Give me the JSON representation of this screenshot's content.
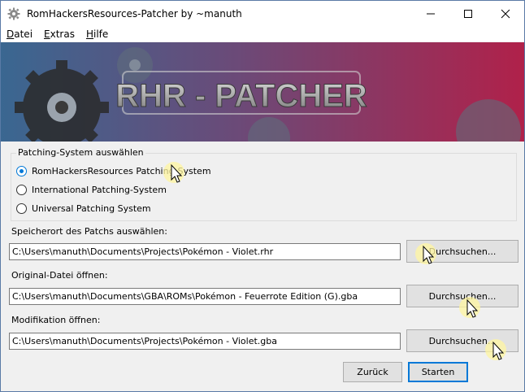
{
  "window": {
    "title": "RomHackersResources-Patcher by ~manuth",
    "caption": {
      "minimize_icon": "minimize-icon",
      "maximize_icon": "maximize-icon",
      "close_icon": "close-icon"
    }
  },
  "menu": [
    {
      "underline": "D",
      "rest": "atei"
    },
    {
      "underline": "E",
      "rest": "xtras"
    },
    {
      "underline": "H",
      "rest": "ilfe"
    }
  ],
  "banner": {
    "text": "RHR - PATCHER",
    "colors": {
      "start": "#3a6791",
      "mid": "#6b4a78",
      "end": "#b0214a"
    }
  },
  "patching_system": {
    "legend": "Patching-System auswählen",
    "options": [
      {
        "label": "RomHackersResources Patching-System",
        "checked": true
      },
      {
        "label": "International Patching-System",
        "checked": false
      },
      {
        "label": "Universal Patching System",
        "checked": false
      }
    ]
  },
  "patch_location": {
    "label": "Speicherort des Patchs auswählen:",
    "value": "C:\\Users\\manuth\\Documents\\Projects\\Pokémon - Violet.rhr",
    "button": "Durchsuchen..."
  },
  "original_file": {
    "label": "Original-Datei öffnen:",
    "value": "C:\\Users\\manuth\\Documents\\GBA\\ROMs\\Pokémon - Feuerrote Edition (G).gba",
    "button": "Durchsuchen..."
  },
  "modification": {
    "label": "Modifikation öffnen:",
    "value": "C:\\Users\\manuth\\Documents\\Projects\\Pokémon - Violet.gba",
    "button": "Durchsuchen..."
  },
  "actions": {
    "back": "Zurück",
    "start": "Starten"
  },
  "colors": {
    "accent": "#0078d7",
    "button_bg": "#e1e1e1",
    "window_bg": "#f0f0f0"
  }
}
